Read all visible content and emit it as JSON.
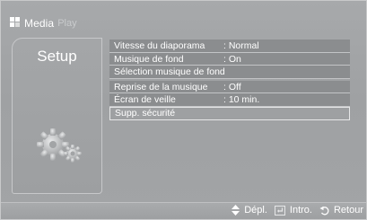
{
  "app": {
    "logo_text": "Media",
    "logo_subtext": "Play"
  },
  "sidebar": {
    "title": "Setup",
    "icon": "gears-icon"
  },
  "menu": {
    "items": [
      {
        "label": "Vitesse du diaporama",
        "value": ": Normal",
        "selected": false
      },
      {
        "label": "Musique de fond",
        "value": ": On",
        "selected": false
      },
      {
        "label": "Sélection musique de fond",
        "value": "",
        "selected": false
      },
      {
        "label": "Reprise de la musique",
        "value": ": Off",
        "selected": false
      },
      {
        "label": "Écran de veille",
        "value": ": 10 min.",
        "selected": false
      },
      {
        "label": "Supp. sécurité",
        "value": "",
        "selected": true
      }
    ]
  },
  "footer": {
    "move_label": "Dépl.",
    "enter_label": "Intro.",
    "return_label": "Retour",
    "move_icon": "updown-arrows-icon",
    "enter_icon": "enter-icon",
    "return_icon": "return-icon"
  },
  "colors": {
    "background": "#a2a4a6",
    "row_background": "#8b8d8f",
    "text": "#ffffff",
    "selection_border": "#e6e7e8"
  }
}
